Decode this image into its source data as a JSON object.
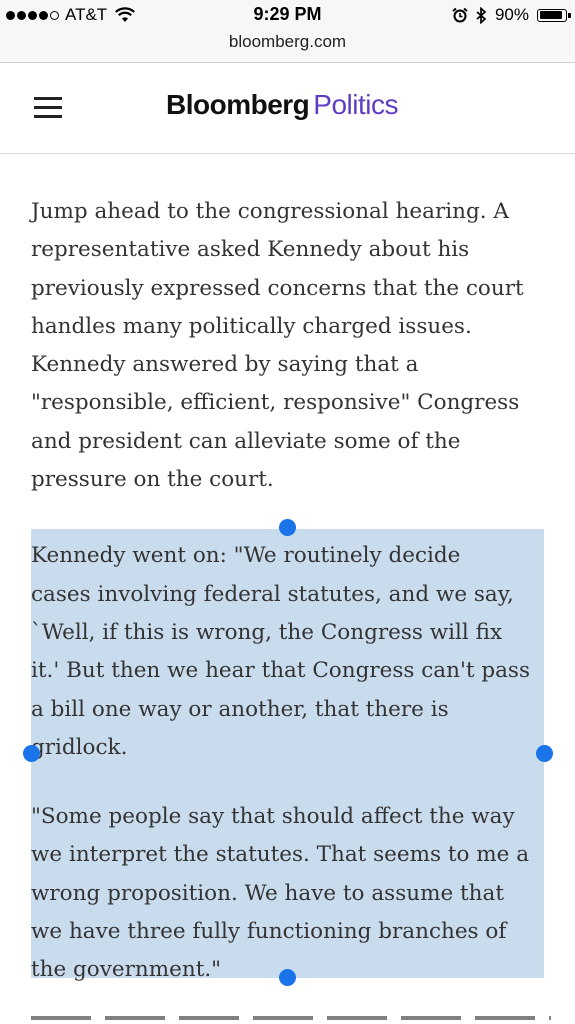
{
  "status_bar": {
    "carrier": "AT&T",
    "time": "9:29 PM",
    "battery": "90%",
    "battery_level": 0.9,
    "icons": [
      "signal-dots-icon",
      "wifi-icon",
      "alarm-icon",
      "bluetooth-icon",
      "battery-icon"
    ]
  },
  "browser": {
    "url": "bloomberg.com"
  },
  "header": {
    "logo_part1": "Bloomberg",
    "logo_part2": "Politics",
    "menu_icon": "hamburger-menu-icon",
    "colors": {
      "logo_accent": "#5f3dc4",
      "selection_highlight": "#c9dcee",
      "selection_handle": "#1a73e8"
    }
  },
  "article": {
    "paragraphs": [
      "Jump ahead to the congressional hearing. A\nrepresentative asked Kennedy about his\npreviously expressed concerns that the court\nhandles many politically charged issues.\nKennedy answered by saying that a\n\"responsible, efficient, responsive\" Congress\nand president can alleviate some of the\npressure on the court.",
      "Kennedy went on: \"We routinely decide\ncases involving federal statutes, and we say,\n`Well, if this is wrong, the Congress will fix\nit.' But then we hear that Congress can't pass\na bill one way or another, that there is\ngridlock.",
      "\"Some people say that should affect the way\nwe interpret the statutes. That seems to me a\nwrong proposition. We have to assume that\nwe have three fully functioning branches of\nthe government.\""
    ]
  }
}
